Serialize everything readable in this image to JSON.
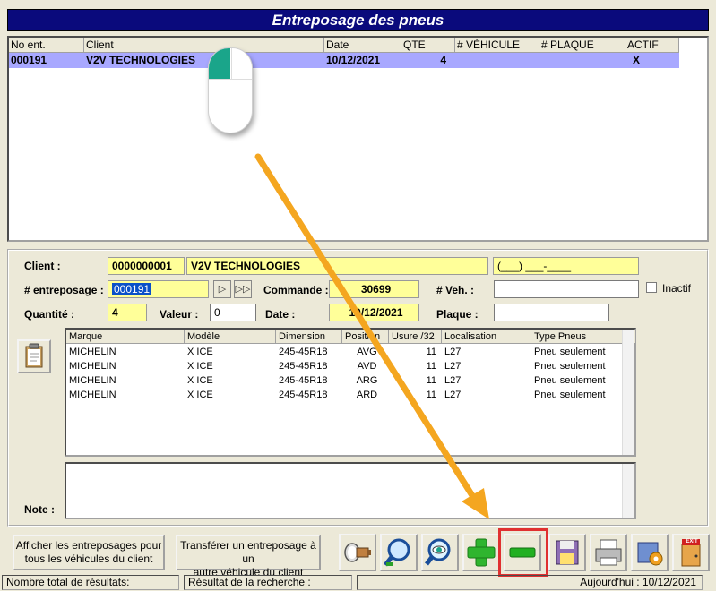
{
  "title": "Entreposage des pneus",
  "results": {
    "headers": [
      "No ent.",
      "Client",
      "Date",
      "QTE",
      "# VÉHICULE",
      "# PLAQUE",
      "ACTIF"
    ],
    "rows": [
      {
        "no_ent": "000191",
        "client": "V2V TECHNOLOGIES",
        "date": "10/12/2021",
        "qte": "4",
        "vehicule": "",
        "plaque": "",
        "actif": "X"
      }
    ]
  },
  "form": {
    "client_label": "Client :",
    "client_code": "0000000001",
    "client_name": "V2V TECHNOLOGIES",
    "client_phone": "(___) ___-____",
    "entreposage_label": "# entreposage :",
    "entreposage_value": "000191",
    "commande_label": "Commande :",
    "commande_value": "30699",
    "veh_label": "# Veh. :",
    "veh_value": "",
    "inactif_label": "Inactif",
    "quantite_label": "Quantité :",
    "quantite_value": "4",
    "valeur_label": "Valeur :",
    "valeur_value": "0",
    "date_label": "Date :",
    "date_value": "10/12/2021",
    "plaque_label": "Plaque :",
    "plaque_value": "",
    "note_label": "Note :"
  },
  "tires": {
    "headers": [
      "Marque",
      "Modèle",
      "Dimension",
      "Position",
      "Usure /32",
      "Localisation",
      "Type Pneus"
    ],
    "rows": [
      {
        "marque": "MICHELIN",
        "modele": "X ICE",
        "dimension": "245-45R18",
        "position": "AVG",
        "usure": "11",
        "localisation": "L27",
        "type": "Pneu seulement"
      },
      {
        "marque": "MICHELIN",
        "modele": "X ICE",
        "dimension": "245-45R18",
        "position": "AVD",
        "usure": "11",
        "localisation": "L27",
        "type": "Pneu seulement"
      },
      {
        "marque": "MICHELIN",
        "modele": "X ICE",
        "dimension": "245-45R18",
        "position": "ARG",
        "usure": "11",
        "localisation": "L27",
        "type": "Pneu seulement"
      },
      {
        "marque": "MICHELIN",
        "modele": "X ICE",
        "dimension": "245-45R18",
        "position": "ARD",
        "usure": "11",
        "localisation": "L27",
        "type": "Pneu seulement"
      }
    ]
  },
  "buttons": {
    "show_all_line1": "Afficher les entreposages pour",
    "show_all_line2": "tous les véhicules du client",
    "transfer_line1": "Transférer un entreposage à un",
    "transfer_line2": "autre véhicule du client",
    "exit_label": "EXIT"
  },
  "icons": [
    "flashlight-icon",
    "search-icon",
    "view-eye-icon",
    "add-plus-icon",
    "remove-minus-icon",
    "save-disk-icon",
    "print-icon",
    "tools-icon",
    "exit-door-icon",
    "clipboard-icon"
  ],
  "colors": {
    "title_bg": "#0a0a7c",
    "selected_row": "#a8a8ff",
    "yellow_field": "#ffff99",
    "highlight_box": "#e03030",
    "arrow": "#f4a620",
    "plus_green": "#2fb52f",
    "minus_green": "#22b022"
  },
  "status": {
    "total_label": "Nombre total de résultats:",
    "search_label": "Résultat de la recherche :",
    "today": "Aujourd'hui : 10/12/2021"
  }
}
